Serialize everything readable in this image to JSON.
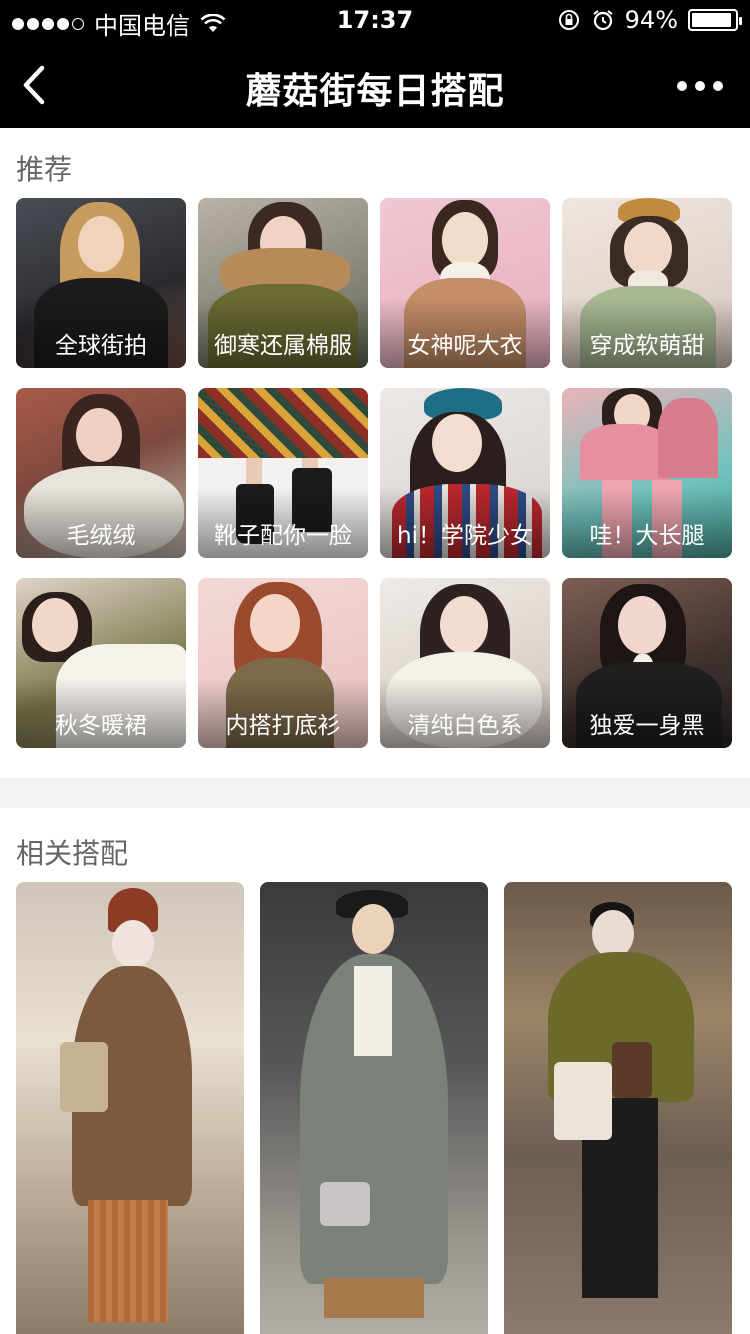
{
  "status_bar": {
    "carrier": "中国电信",
    "time": "17:37",
    "battery_percent": "94%",
    "battery_level": 0.94
  },
  "nav": {
    "title": "蘑菇街每日搭配",
    "back_icon": "chevron-left-icon",
    "more_icon": "more-dots-icon"
  },
  "recommend": {
    "title": "推荐",
    "items": [
      {
        "label": "全球街拍"
      },
      {
        "label": "御寒还属棉服"
      },
      {
        "label": "女神呢大衣"
      },
      {
        "label": "穿成软萌甜"
      },
      {
        "label": "毛绒绒"
      },
      {
        "label": "靴子配你一脸"
      },
      {
        "label": "hi！学院少女"
      },
      {
        "label": "哇！大长腿"
      },
      {
        "label": "秋冬暖裙"
      },
      {
        "label": "内搭打底衫"
      },
      {
        "label": "清纯白色系"
      },
      {
        "label": "独爱一身黑"
      }
    ]
  },
  "related": {
    "title": "相关搭配"
  }
}
